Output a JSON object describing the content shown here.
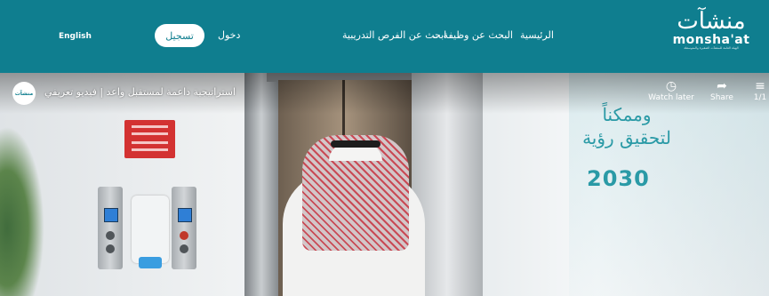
{
  "nav": {
    "language": "English",
    "register_label": "تسجيل",
    "login_label": "دخول",
    "training_label": "ابحث عن الفرص التدريبية",
    "jobs_label": "البحث عن وظيفة",
    "home_label": "الرئيسية"
  },
  "logo": {
    "arabic": "منشآت",
    "english": "monsha'at",
    "subtitle": "الهيئة العامة للمنشآت الصغيرة والمتوسطة"
  },
  "video": {
    "channel": "منشآت",
    "title": "استراتيجية داعمة لمستقبل واعد | فيديو تعريفي",
    "watch_later": "Watch later",
    "share": "Share",
    "more_count": "1/1",
    "poster_text": "وممكناً لتحقيق رؤية",
    "vision": "2030"
  },
  "colors": {
    "brand": "#0f7e8f",
    "white": "#ffffff"
  }
}
